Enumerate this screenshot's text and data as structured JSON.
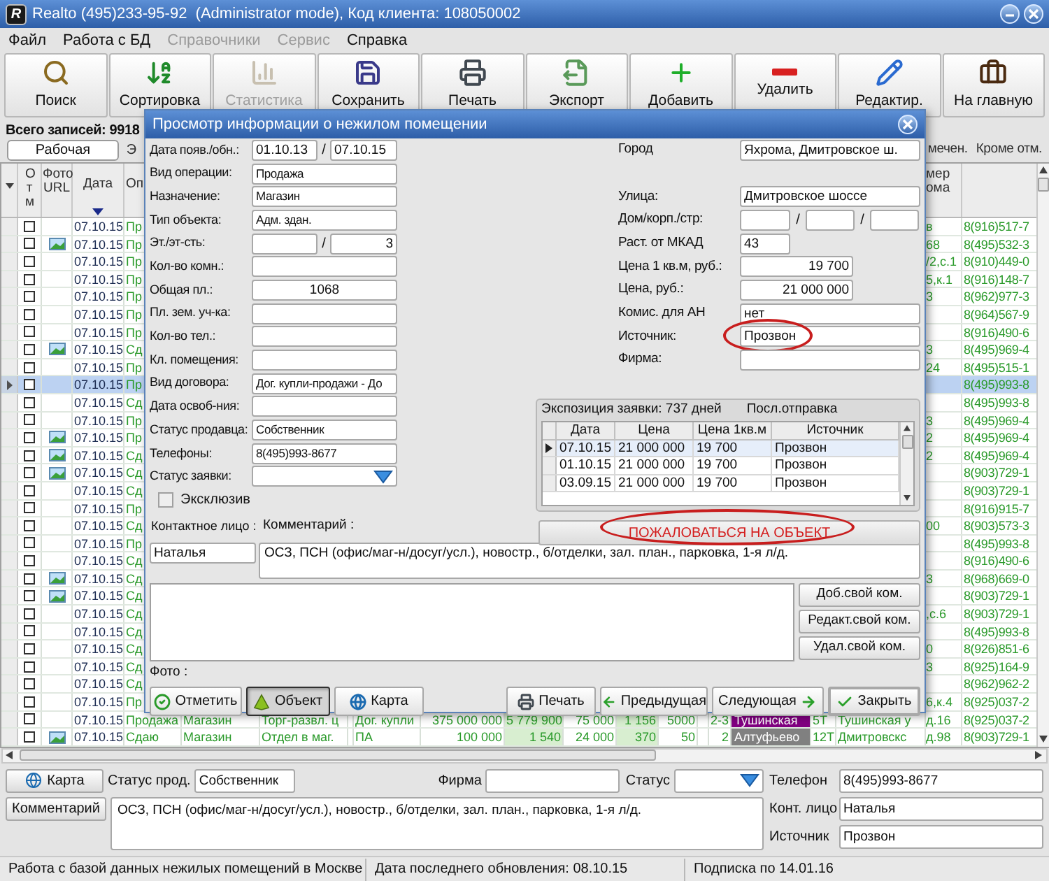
{
  "window": {
    "logo": "R",
    "title": "Realto (495)233-95-92  (Administrator mode), Код клиента: 108050002"
  },
  "menu": [
    {
      "label": "Файл",
      "disabled": false
    },
    {
      "label": "Работа с БД",
      "disabled": false
    },
    {
      "label": "Справочники",
      "disabled": true
    },
    {
      "label": "Сервис",
      "disabled": true
    },
    {
      "label": "Справка",
      "disabled": false
    }
  ],
  "toolbar": [
    {
      "label": "Поиск",
      "kind": "search",
      "disabled": false
    },
    {
      "label": "Сортировка",
      "kind": "sort",
      "disabled": false
    },
    {
      "label": "Статистика",
      "kind": "stats",
      "disabled": true
    },
    {
      "label": "Сохранить",
      "kind": "save",
      "disabled": false
    },
    {
      "label": "Печать",
      "kind": "print",
      "disabled": false
    },
    {
      "label": "Экспорт",
      "kind": "export",
      "disabled": false
    },
    {
      "label": "Добавить",
      "kind": "add",
      "disabled": false
    },
    {
      "label": "Удалить",
      "kind": "remove",
      "disabled": false
    },
    {
      "label": "Редактир.",
      "kind": "edit",
      "disabled": false
    },
    {
      "label": "На главную",
      "kind": "home",
      "disabled": false
    }
  ],
  "record_count": "Всего записей: 9918",
  "tabs_left": [
    {
      "label": "Рабочая",
      "selected": true
    },
    {
      "label": "Э",
      "selected": false
    }
  ],
  "tabs_right": [
    {
      "label": "мечен.",
      "selected": false
    },
    {
      "label": "Кроме отм.",
      "selected": false
    }
  ],
  "table": {
    "columns": [
      {
        "label": "Отм",
        "sorted": false
      },
      {
        "label": "Фото URL",
        "sorted": false
      },
      {
        "label": "Дата",
        "sorted": true
      },
      {
        "label": "Оп",
        "sorted": false
      },
      {
        "label": "мер ома",
        "sorted": false
      }
    ],
    "rows": [
      {
        "selected": false,
        "checked": false,
        "photo": false,
        "date": "07.10.15",
        "op": "Пр",
        "house": "в",
        "phone": "8(916)517-7"
      },
      {
        "selected": false,
        "checked": false,
        "photo": true,
        "date": "07.10.15",
        "op": "Пр",
        "house": "68",
        "phone": "8(495)532-3"
      },
      {
        "selected": false,
        "checked": false,
        "photo": false,
        "date": "07.10.15",
        "op": "Пр",
        "house": "/2,с.1",
        "phone": "8(910)449-0"
      },
      {
        "selected": false,
        "checked": false,
        "photo": false,
        "date": "07.10.15",
        "op": "Пр",
        "house": "5,к.1",
        "phone": "8(916)148-7"
      },
      {
        "selected": false,
        "checked": false,
        "photo": false,
        "date": "07.10.15",
        "op": "Пр",
        "house": "3",
        "phone": "8(962)977-3"
      },
      {
        "selected": false,
        "checked": false,
        "photo": false,
        "date": "07.10.15",
        "op": "Пр",
        "phone": "8(964)567-9"
      },
      {
        "selected": false,
        "checked": false,
        "photo": false,
        "date": "07.10.15",
        "op": "Пр",
        "phone": "8(916)490-6"
      },
      {
        "selected": false,
        "checked": false,
        "photo": true,
        "date": "07.10.15",
        "op": "Сд",
        "house": "3",
        "phone": "8(495)969-4"
      },
      {
        "selected": false,
        "checked": false,
        "photo": false,
        "date": "07.10.15",
        "op": "Пр",
        "house": "24",
        "phone": "8(495)515-1"
      },
      {
        "selected": true,
        "checked": false,
        "photo": false,
        "date": "07.10.15",
        "op": "Пр",
        "phone": "8(495)993-8"
      },
      {
        "selected": false,
        "checked": false,
        "photo": false,
        "date": "07.10.15",
        "op": "Сд",
        "phone": "8(495)993-8"
      },
      {
        "selected": false,
        "checked": false,
        "photo": false,
        "date": "07.10.15",
        "op": "Пр",
        "house": "3",
        "phone": "8(495)969-4"
      },
      {
        "selected": false,
        "checked": false,
        "photo": true,
        "date": "07.10.15",
        "op": "Пр",
        "house": "2",
        "phone": "8(495)969-4"
      },
      {
        "selected": false,
        "checked": false,
        "photo": true,
        "date": "07.10.15",
        "op": "Сд",
        "house": "2",
        "phone": "8(495)969-4"
      },
      {
        "selected": false,
        "checked": false,
        "photo": true,
        "date": "07.10.15",
        "op": "Сд",
        "phone": "8(903)729-1"
      },
      {
        "selected": false,
        "checked": false,
        "photo": false,
        "date": "07.10.15",
        "op": "Сд",
        "phone": "8(903)729-1"
      },
      {
        "selected": false,
        "checked": false,
        "photo": false,
        "date": "07.10.15",
        "op": "Пр",
        "phone": "8(916)915-7"
      },
      {
        "selected": false,
        "checked": false,
        "photo": false,
        "date": "07.10.15",
        "op": "Сд",
        "house": "00",
        "phone": "8(903)573-3"
      },
      {
        "selected": false,
        "checked": false,
        "photo": false,
        "date": "07.10.15",
        "op": "Пр",
        "phone": "8(495)993-8"
      },
      {
        "selected": false,
        "checked": false,
        "photo": false,
        "date": "07.10.15",
        "op": "Сд",
        "phone": "8(916)490-6"
      },
      {
        "selected": false,
        "checked": false,
        "photo": true,
        "date": "07.10.15",
        "op": "Сд",
        "house": "3",
        "phone": "8(968)669-0"
      },
      {
        "selected": false,
        "checked": false,
        "photo": true,
        "date": "07.10.15",
        "op": "Сд",
        "phone": "8(903)729-1"
      },
      {
        "selected": false,
        "checked": false,
        "photo": false,
        "date": "07.10.15",
        "op": "Сд",
        "house": ",с.6",
        "phone": "8(903)729-1"
      },
      {
        "selected": false,
        "checked": false,
        "photo": false,
        "date": "07.10.15",
        "op": "Сд",
        "phone": "8(495)993-8"
      },
      {
        "selected": false,
        "checked": false,
        "photo": false,
        "date": "07.10.15",
        "op": "Сд",
        "house": "0",
        "phone": "8(926)851-6"
      },
      {
        "selected": false,
        "checked": false,
        "photo": false,
        "date": "07.10.15",
        "op": "Сд",
        "house": "3",
        "phone": "8(925)164-9"
      },
      {
        "selected": false,
        "checked": false,
        "photo": false,
        "date": "07.10.15",
        "op": "Сд",
        "phone": "8(962)962-2"
      },
      {
        "selected": false,
        "checked": false,
        "photo": false,
        "date": "07.10.15",
        "op": "Пр",
        "house": "6,к.4",
        "phone": "8(925)037-2"
      },
      {
        "selected": false,
        "checked": false,
        "photo": false,
        "date": "07.10.15",
        "op": "Продажа",
        "cells": [
          {
            "kind": "text",
            "text": "Магазин"
          },
          {
            "kind": "text",
            "text": "Торг-развл. ц"
          },
          {
            "kind": "gap"
          },
          {
            "kind": "text",
            "text": "Дог. купли"
          },
          {
            "kind": "num",
            "text": "375 000 000"
          },
          {
            "kind": "hl",
            "text": "5 779 900"
          },
          {
            "kind": "num",
            "text": "75 000"
          },
          {
            "kind": "hl",
            "text": "1 156"
          },
          {
            "kind": "num",
            "text": "5000"
          },
          {
            "kind": "gap"
          },
          {
            "kind": "num",
            "text": "2-3"
          },
          {
            "kind": "metro",
            "text": "Тушинская",
            "color": "#800080"
          },
          {
            "kind": "text",
            "text": "5Т"
          },
          {
            "kind": "text",
            "text": "Тушинская у"
          }
        ],
        "house": "д.16",
        "phone": "8(925)037-2"
      },
      {
        "selected": false,
        "checked": false,
        "photo": true,
        "date": "07.10.15",
        "op": "Сдаю",
        "cells": [
          {
            "kind": "text",
            "text": "Магазин"
          },
          {
            "kind": "text",
            "text": "Отдел в маг."
          },
          {
            "kind": "gap"
          },
          {
            "kind": "text",
            "text": "ПА"
          },
          {
            "kind": "num",
            "text": "100 000"
          },
          {
            "kind": "hl",
            "text": "1 540"
          },
          {
            "kind": "num",
            "text": "24 000"
          },
          {
            "kind": "hl",
            "text": "370"
          },
          {
            "kind": "num",
            "text": "50"
          },
          {
            "kind": "gap"
          },
          {
            "kind": "num",
            "text": "2"
          },
          {
            "kind": "metro",
            "text": "Алтуфьево",
            "color": "#808080"
          },
          {
            "kind": "text",
            "text": "12Т"
          },
          {
            "kind": "text",
            "text": "Дмитровскс"
          }
        ],
        "house": "д.98",
        "phone": "8(903)729-1"
      }
    ]
  },
  "dialog": {
    "title": "Просмотр информации о нежилом помещении",
    "left_fields": [
      {
        "kind": "pair",
        "label": "Дата появ./обн.:",
        "first": "01.10.13",
        "separator": "/",
        "second": "07.10.15"
      },
      {
        "kind": "text",
        "label": "Вид операции:",
        "value": "Продажа"
      },
      {
        "kind": "text",
        "label": "Назначение:",
        "value": "Магазин"
      },
      {
        "kind": "text",
        "label": "Тип объекта:",
        "value": "Адм. здан."
      },
      {
        "kind": "pair",
        "label": "Эт./эт-сть:",
        "separator": "/",
        "second": "3"
      },
      {
        "kind": "text",
        "label": "Кол-во комн.:"
      },
      {
        "kind": "number",
        "label": "Общая пл.:",
        "value": "1068"
      },
      {
        "kind": "text",
        "label": "Пл. зем. уч-ка:"
      },
      {
        "kind": "text",
        "label": "Кол-во тел.:"
      },
      {
        "kind": "text",
        "label": "Кл. помещения:"
      },
      {
        "kind": "text",
        "label": "Вид договора:",
        "value": "Дог. купли-продажи - До"
      },
      {
        "kind": "text",
        "label": "Дата освоб-ния:"
      },
      {
        "kind": "text",
        "label": "Статус продавца:",
        "value": "Собственник"
      },
      {
        "kind": "text",
        "label": "Телефоны:",
        "value": "8(495)993-8677"
      },
      {
        "kind": "select",
        "label": "Статус заявки:"
      },
      {
        "kind": "checkbox",
        "label": "Эксклюзив",
        "checked": false
      }
    ],
    "right_fields": [
      {
        "kind": "text",
        "label": "Город",
        "value": "Яхрома, Дмитровское ш.",
        "circled": false
      },
      {
        "kind": "gap"
      },
      {
        "kind": "text",
        "label": "Улица:",
        "value": "Дмитровское шоссе",
        "circled": false
      },
      {
        "kind": "triple",
        "label": "Дом/корп./стр:",
        "separators": [
          "/",
          "/"
        ]
      },
      {
        "kind": "short",
        "label": "Раст. от МКАД",
        "value": "43"
      },
      {
        "kind": "number",
        "label": "Цена 1 кв.м, руб.:",
        "value": "19 700"
      },
      {
        "kind": "number",
        "label": "Цена, руб.:",
        "value": "21 000 000"
      },
      {
        "kind": "text",
        "label": "Комис. для АН",
        "value": "нет",
        "circled": false
      },
      {
        "kind": "text",
        "label": "Источник:",
        "value": "Прозвон",
        "circled": true
      },
      {
        "kind": "text",
        "label": "Фирма:",
        "circled": false
      }
    ],
    "history": {
      "title": "Экспозиция заявки: 737 дней",
      "last_sent": "Посл.отправка",
      "columns": [
        "Дата",
        "Цена",
        "Цена 1кв.м",
        "Источник"
      ],
      "rows": [
        {
          "selected": true,
          "cells": [
            "07.10.15",
            "21 000 000",
            "19 700",
            "Прозвон"
          ]
        },
        {
          "selected": false,
          "cells": [
            "01.10.15",
            "21 000 000",
            "19 700",
            "Прозвон"
          ]
        },
        {
          "selected": false,
          "cells": [
            "03.09.15",
            "21 000 000",
            "19 700",
            "Прозвон"
          ]
        }
      ]
    },
    "contact_label": "Контактное лицо :",
    "comment_label": "Комментарий :",
    "complaint_button": {
      "label": "ПОЖАЛОВАТЬСЯ НА ОБЪЕКТ",
      "circled": true
    },
    "contact": "Наталья",
    "comment": "ОСЗ, ПСН (офис/маг-н/досуг/усл.), новостр., б/отделки, зал. план., парковка, 1-я л/д.",
    "own_comment_buttons": [
      "Доб.свой ком.",
      "Редакт.свой ком.",
      "Удал.свой ком."
    ],
    "photo_label": "Фото :",
    "left_buttons": [
      {
        "label": "Отметить",
        "kind": "mark",
        "pressed": false,
        "is_default": false
      },
      {
        "label": "Объект",
        "kind": "object",
        "pressed": true,
        "is_default": false
      },
      {
        "label": "Карта",
        "kind": "map",
        "pressed": false,
        "is_default": false
      }
    ],
    "right_buttons": [
      {
        "label": "Печать",
        "kind": "print",
        "pressed": false,
        "is_default": false
      },
      {
        "label": "Предыдущая",
        "kind": "prev",
        "pressed": false,
        "is_default": false
      },
      {
        "label": "Следующая",
        "kind": "next",
        "pressed": false,
        "is_default": false
      },
      {
        "label": "Закрыть",
        "kind": "close",
        "pressed": false,
        "is_default": true
      }
    ]
  },
  "details": {
    "map_button": "Карта",
    "seller_status_label": "Статус прод.",
    "seller_status": "Собственник",
    "firm_label": "Фирма",
    "status_label": "Статус",
    "phone_label": "Телефон",
    "phone": "8(495)993-8677",
    "comment_button": "Комментарий",
    "comment": "ОСЗ, ПСН (офис/маг-н/досуг/усл.), новостр., б/отделки, зал. план., парковка, 1-я л/д.",
    "contact_label": "Конт. лицо",
    "contact": "Наталья",
    "source_label": "Источник",
    "source": "Прозвон"
  },
  "status_bar": [
    "Работа с базой данных нежилых помещений в Москве",
    "Дата последнего обновления: 08.10.15",
    "Подписка по 14.01.16"
  ]
}
